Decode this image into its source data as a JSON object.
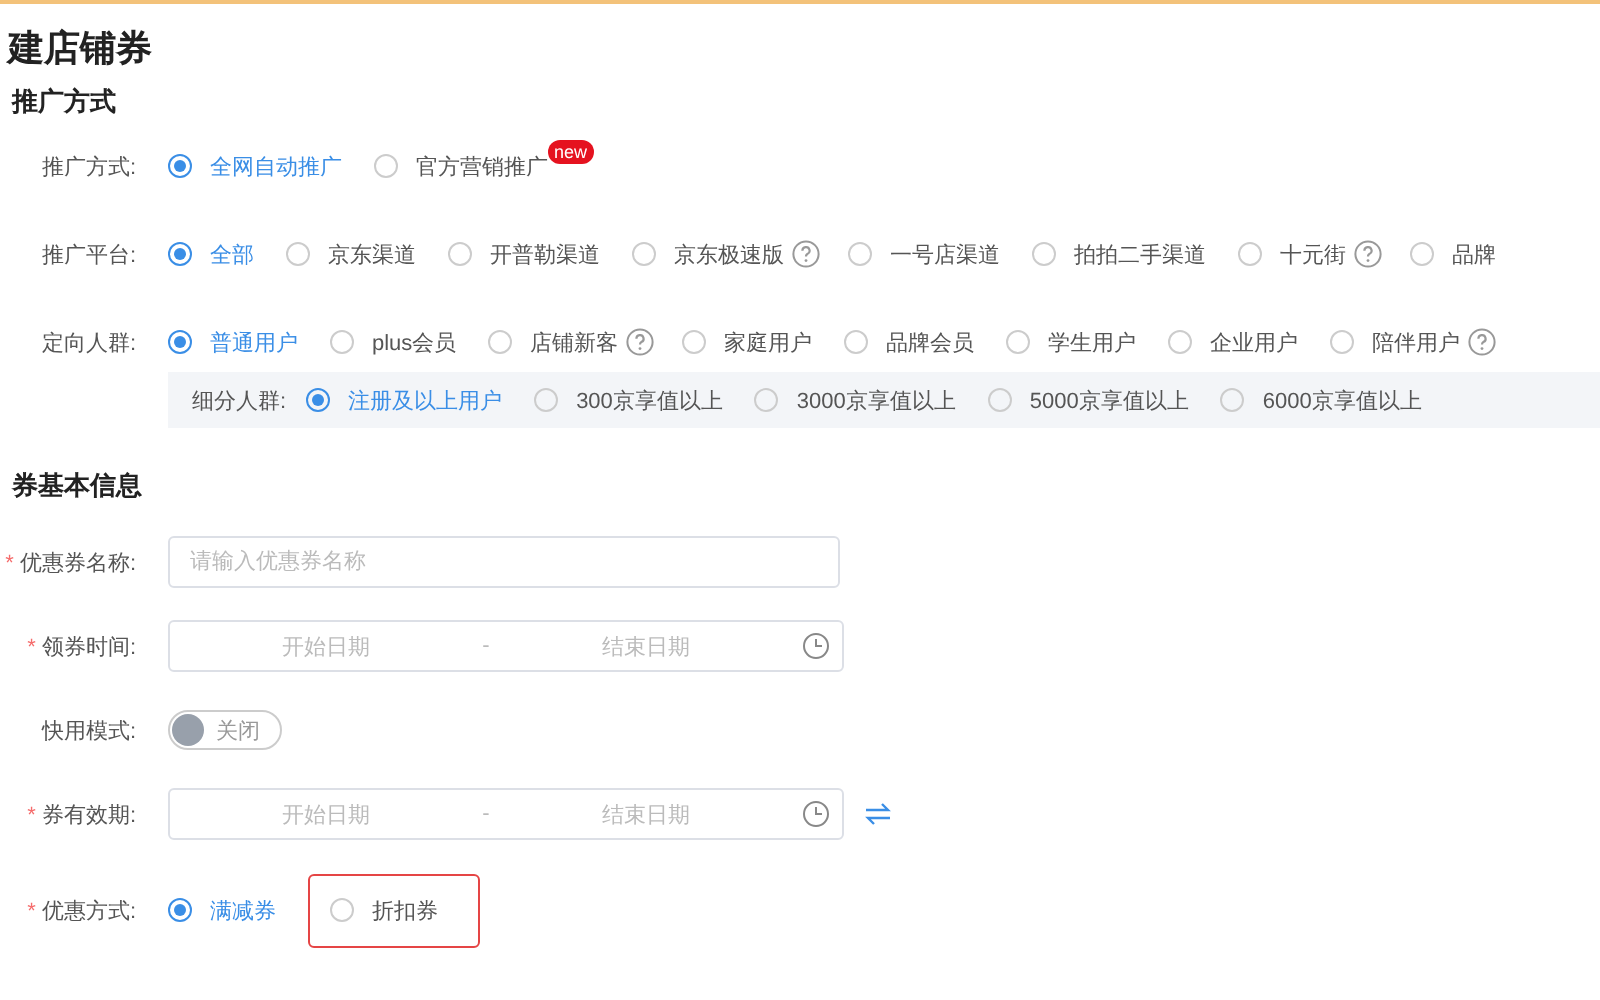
{
  "page_title": "建店铺券",
  "promo_section": {
    "heading": "推广方式",
    "rows": [
      {
        "label": "推广方式:",
        "options": [
          {
            "label": "全网自动推广",
            "selected": true
          },
          {
            "label": "官方营销推广",
            "selected": false,
            "badge": "new"
          }
        ]
      },
      {
        "label": "推广平台:",
        "options": [
          {
            "label": "全部",
            "selected": true
          },
          {
            "label": "京东渠道",
            "selected": false
          },
          {
            "label": "开普勒渠道",
            "selected": false
          },
          {
            "label": "京东极速版",
            "selected": false,
            "help": true
          },
          {
            "label": "一号店渠道",
            "selected": false
          },
          {
            "label": "拍拍二手渠道",
            "selected": false
          },
          {
            "label": "十元街",
            "selected": false,
            "help": true
          },
          {
            "label": "品牌",
            "selected": false
          }
        ]
      },
      {
        "label": "定向人群:",
        "options": [
          {
            "label": "普通用户",
            "selected": true
          },
          {
            "label": "plus会员",
            "selected": false
          },
          {
            "label": "店铺新客",
            "selected": false,
            "help": true
          },
          {
            "label": "家庭用户",
            "selected": false
          },
          {
            "label": "品牌会员",
            "selected": false
          },
          {
            "label": "学生用户",
            "selected": false
          },
          {
            "label": "企业用户",
            "selected": false
          },
          {
            "label": "陪伴用户",
            "selected": false,
            "help": true
          }
        ]
      }
    ],
    "sub_panel": {
      "label": "细分人群:",
      "options": [
        {
          "label": "注册及以上用户",
          "selected": true
        },
        {
          "label": "300京享值以上",
          "selected": false
        },
        {
          "label": "3000京享值以上",
          "selected": false
        },
        {
          "label": "5000京享值以上",
          "selected": false
        },
        {
          "label": "6000京享值以上",
          "selected": false
        }
      ]
    }
  },
  "basic_section": {
    "heading": "券基本信息",
    "fields": [
      {
        "kind": "text",
        "label": "优惠券名称:",
        "required_mark": "*",
        "placeholder": "请输入优惠券名称"
      },
      {
        "kind": "daterange",
        "label": "领券时间:",
        "required_mark": "*",
        "start_placeholder": "开始日期",
        "end_placeholder": "结束日期",
        "separator": "-"
      },
      {
        "kind": "switch",
        "label": "快用模式:",
        "on": false,
        "text": "关闭"
      },
      {
        "kind": "daterange",
        "label": "券有效期:",
        "required_mark": "*",
        "start_placeholder": "开始日期",
        "end_placeholder": "结束日期",
        "separator": "-",
        "swap": true
      },
      {
        "kind": "radio",
        "label": "优惠方式:",
        "required_mark": "*",
        "options": [
          {
            "label": "满减券",
            "selected": true
          },
          {
            "label": "折扣券",
            "selected": false,
            "highlighted": true
          }
        ]
      }
    ]
  }
}
